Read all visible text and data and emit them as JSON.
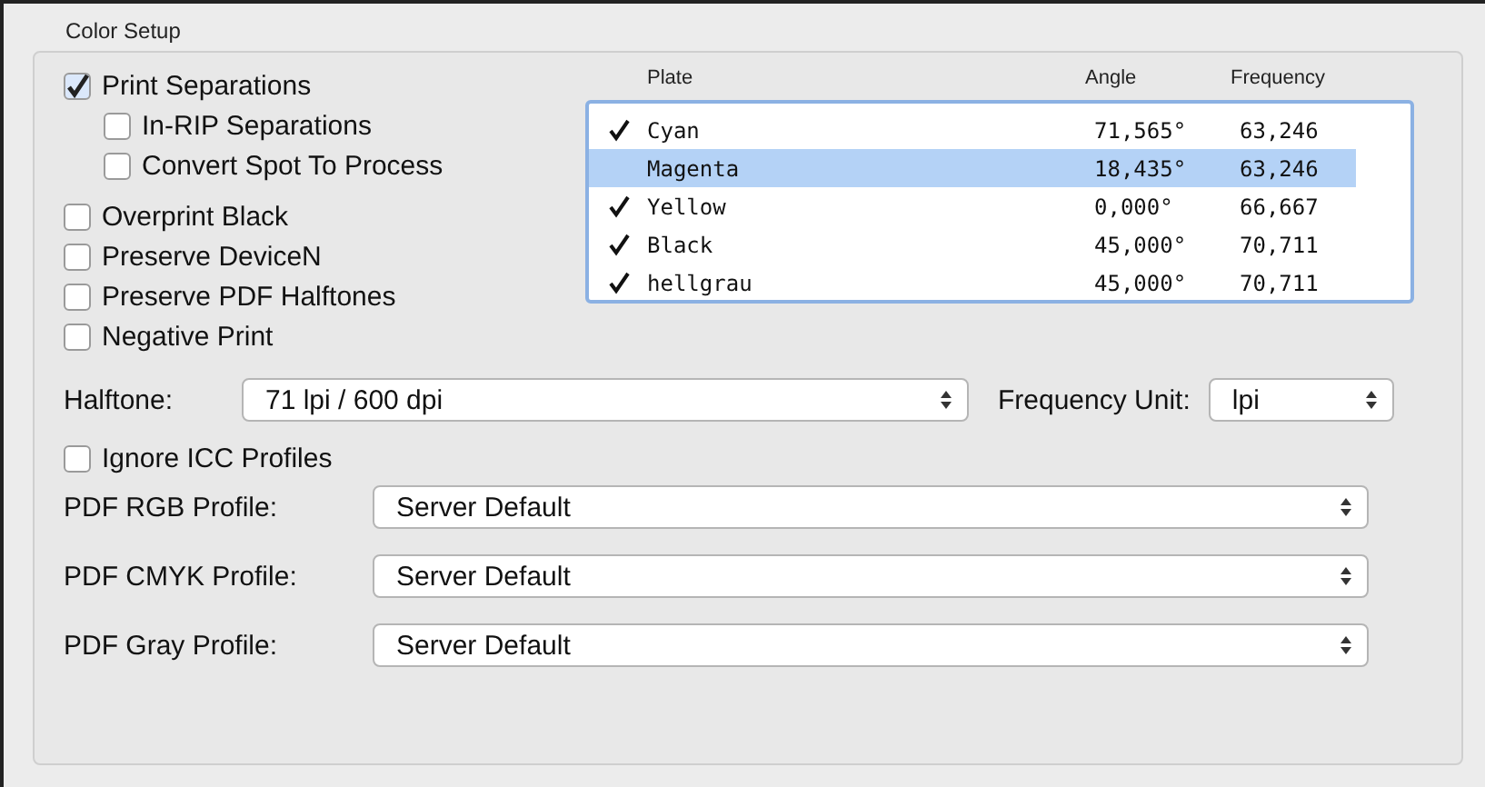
{
  "group": {
    "title": "Color Setup"
  },
  "options": [
    {
      "label": "Print Separations",
      "checked": true,
      "children": [
        {
          "label": "In-RIP Separations",
          "checked": false
        },
        {
          "label": "Convert Spot To Process",
          "checked": false
        }
      ]
    },
    {
      "label": "Overprint Black",
      "checked": false
    },
    {
      "label": "Preserve DeviceN",
      "checked": false
    },
    {
      "label": "Preserve PDF Halftones",
      "checked": false
    },
    {
      "label": "Negative Print",
      "checked": false
    }
  ],
  "plates": {
    "columns": [
      "Plate",
      "Angle",
      "Frequency"
    ],
    "rows": [
      {
        "checked": true,
        "selected": false,
        "plate": "Cyan",
        "angle": "71,565°",
        "frequency": "63,246"
      },
      {
        "checked": false,
        "selected": true,
        "plate": "Magenta",
        "angle": "18,435°",
        "frequency": "63,246"
      },
      {
        "checked": true,
        "selected": false,
        "plate": "Yellow",
        "angle": "0,000°",
        "frequency": "66,667"
      },
      {
        "checked": true,
        "selected": false,
        "plate": "Black",
        "angle": "45,000°",
        "frequency": "70,711"
      },
      {
        "checked": true,
        "selected": false,
        "plate": "hellgrau",
        "angle": "45,000°",
        "frequency": "70,711"
      }
    ]
  },
  "halftone": {
    "label": "Halftone:",
    "value": "71 lpi / 600 dpi"
  },
  "frequency_unit": {
    "label": "Frequency Unit:",
    "value": "lpi"
  },
  "ignore_icc": {
    "label": "Ignore ICC Profiles",
    "checked": false
  },
  "profiles": [
    {
      "label": "PDF RGB Profile:",
      "value": "Server Default"
    },
    {
      "label": "PDF CMYK Profile:",
      "value": "Server Default"
    },
    {
      "label": "PDF Gray Profile:",
      "value": "Server Default"
    }
  ]
}
